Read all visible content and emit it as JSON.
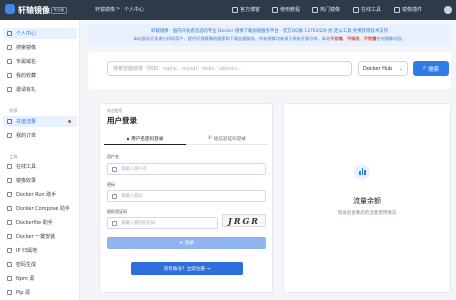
{
  "app": {
    "name": "轩辕镜像",
    "badge": "专业版",
    "breadcrumb": [
      "轩辕镜像",
      ">",
      "个人中心"
    ]
  },
  "topnav": [
    {
      "label": "官方博客",
      "icon": "book-icon"
    },
    {
      "label": "使用教程",
      "icon": "help-icon"
    },
    {
      "label": "热门镜像",
      "icon": "fire-icon"
    },
    {
      "label": "在线工具",
      "icon": "tools-icon"
    },
    {
      "label": "镜像插件",
      "icon": "plugin-icon"
    }
  ],
  "sidebar": {
    "top_items": [
      {
        "label": "个人中心",
        "icon": "user-icon",
        "active": true
      },
      {
        "label": "搜索镜像",
        "icon": "search-icon"
      },
      {
        "label": "专属域名",
        "icon": "globe-icon"
      },
      {
        "label": "我的收藏",
        "icon": "heart-icon"
      },
      {
        "label": "邀请有礼",
        "icon": "gift-icon"
      }
    ],
    "section_assets": "资源",
    "asset_items": [
      {
        "label": "充值流量",
        "icon": "card-icon",
        "active": true
      },
      {
        "label": "我的订单",
        "icon": "order-icon"
      }
    ],
    "section_tools": "工具",
    "tool_items": [
      {
        "label": "在线工具",
        "icon": "tools-icon"
      },
      {
        "label": "镜像收录",
        "icon": "archive-icon"
      },
      {
        "label": "Docker Run 助手",
        "icon": "terminal-icon"
      },
      {
        "label": "Docker Compose 助手",
        "icon": "file-icon"
      },
      {
        "label": "Dockerfile 助手",
        "icon": "doc-icon"
      },
      {
        "label": "Docker 一键安装",
        "icon": "download-icon"
      },
      {
        "label": "IP 归属地",
        "icon": "location-icon"
      },
      {
        "label": "密码生成",
        "icon": "key-icon"
      },
      {
        "label": "Npm 源",
        "icon": "package-icon"
      },
      {
        "label": "Pip 源",
        "icon": "package-icon"
      }
    ]
  },
  "notice": {
    "line1": "轩辕镜像 · 国内开发者首选的专业 Docker 镜像下载加速服务平台 · 官方QQ群 13763429 抢 定公工具 免费获得技术支持",
    "line2_a": "本站面向开发者与科研用户，提供开源镜像的搜索和下载加速服务，所有镜像均来源于原始开源仓库，本站",
    "line2_warn1": "不存储",
    "line2_b": "、",
    "line2_warn2": "不修改",
    "line2_c": "、",
    "line2_warn3": "不传播",
    "line2_d": "任何镜像内容。"
  },
  "search": {
    "placeholder": "搜索容器镜像（例如：nginx、mysql、redis、ubuntu...",
    "registry": "Docker Hub",
    "button": "搜索"
  },
  "login": {
    "subtitle": "欢迎使用",
    "title": "用户登录",
    "tab_password": "用户名密码登录",
    "tab_sms": "短信验证码登录",
    "username_label": "用户名",
    "username_placeholder": "请输入用户名",
    "password_label": "密码",
    "password_placeholder": "请输入密码",
    "captcha_label": "图形验证码",
    "captcha_placeholder": "请输入图形验证码",
    "captcha_text": "JRGR",
    "login_button": "登录",
    "register_button": "没有账号？立即注册 →"
  },
  "quota": {
    "title": "流量余额",
    "desc": "登录后查看您的流量使用情况"
  },
  "colors": {
    "accent": "#2f7bea",
    "topbar": "#2d3a48",
    "warning": "#e0463a"
  }
}
